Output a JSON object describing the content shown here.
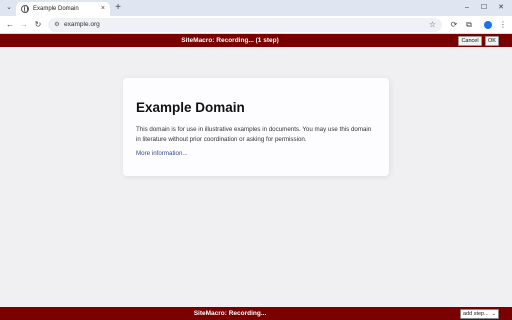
{
  "browser": {
    "tab": {
      "title": "Example Domain",
      "close_glyph": "×"
    },
    "new_tab_glyph": "+",
    "tab_search_glyph": "⌄",
    "window_controls": {
      "minimize": "–",
      "maximize": "☐",
      "close": "✕"
    },
    "toolbar": {
      "back_glyph": "←",
      "forward_glyph": "→",
      "reload_glyph": "↻",
      "site_info_glyph": "⚙",
      "url": "example.org",
      "bookmark_glyph": "☆",
      "extension_glyph_1": "⟳",
      "extension_glyph_2": "⧉",
      "menu_glyph": "⋮"
    }
  },
  "recorder": {
    "top_status": "SiteMacro: Recording... (1 step)",
    "cancel_label": "Cancel",
    "ok_label": "OK",
    "bottom_status": "SiteMacro: Recording...",
    "add_step_label": "add step...",
    "add_step_caret": "⌄",
    "bar_color": "#7a0000"
  },
  "page": {
    "title": "Example Domain",
    "body": "This domain is for use in illustrative examples in documents. You may use this domain in literature without prior coordination or asking for permission.",
    "link_text": "More information..."
  }
}
